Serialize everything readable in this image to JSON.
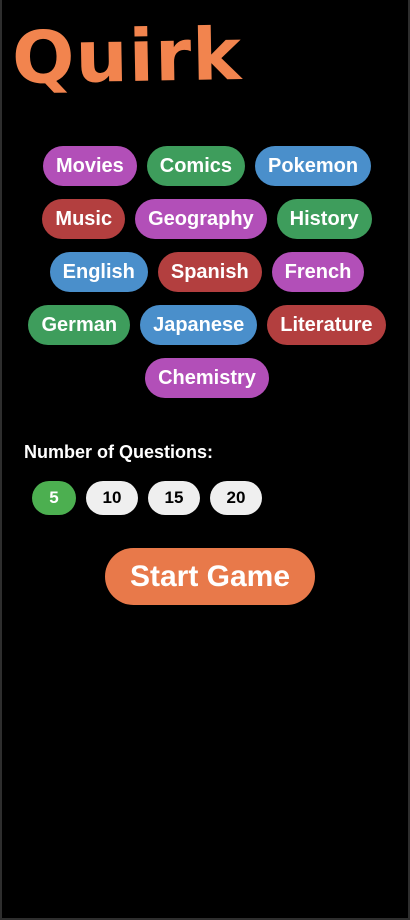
{
  "app": {
    "title": "Quirk",
    "brand_color": "#f2844e"
  },
  "topics": [
    {
      "label": "Movies",
      "color": "#b24fb8"
    },
    {
      "label": "Comics",
      "color": "#3e9d5c"
    },
    {
      "label": "Pokemon",
      "color": "#4a8fcb"
    },
    {
      "label": "Music",
      "color": "#b33f3f"
    },
    {
      "label": "Geography",
      "color": "#b24fb8"
    },
    {
      "label": "History",
      "color": "#3e9d5c"
    },
    {
      "label": "English",
      "color": "#4a8fcb"
    },
    {
      "label": "Spanish",
      "color": "#b33f3f"
    },
    {
      "label": "French",
      "color": "#b24fb8"
    },
    {
      "label": "German",
      "color": "#3e9d5c"
    },
    {
      "label": "Japanese",
      "color": "#4a8fcb"
    },
    {
      "label": "Literature",
      "color": "#b33f3f"
    },
    {
      "label": "Chemistry",
      "color": "#b24fb8"
    }
  ],
  "questions": {
    "label": "Number of Questions:",
    "options": [
      "5",
      "10",
      "15",
      "20"
    ],
    "selected": "5",
    "selected_color": "#4caf50",
    "unselected_color": "#efefef"
  },
  "start": {
    "label": "Start Game",
    "color": "#e8794a"
  }
}
